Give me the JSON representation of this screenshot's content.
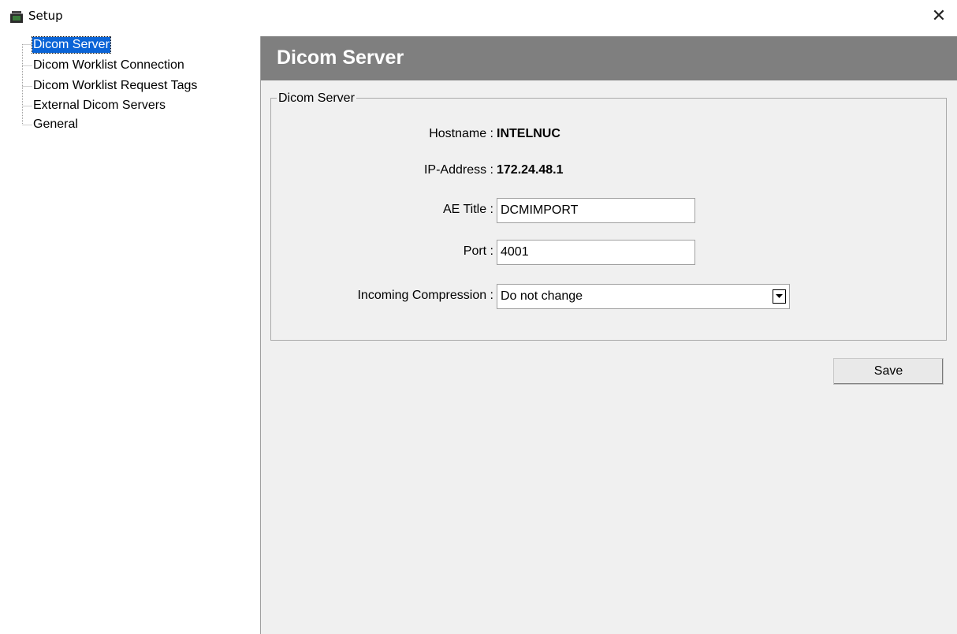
{
  "window": {
    "title": "Setup",
    "close_glyph": "✕",
    "icon": "setup-app-icon"
  },
  "tree": {
    "items": [
      {
        "label": "Dicom Server",
        "selected": true
      },
      {
        "label": "Dicom Worklist Connection",
        "selected": false
      },
      {
        "label": "Dicom Worklist Request Tags",
        "selected": false
      },
      {
        "label": "External Dicom Servers",
        "selected": false
      },
      {
        "label": "General",
        "selected": false
      }
    ]
  },
  "panel": {
    "header_title": "Dicom Server",
    "group_title": "Dicom Server",
    "hostname_label": "Hostname :",
    "hostname_value": "INTELNUC",
    "ip_label": "IP-Address :",
    "ip_value": "172.24.48.1",
    "ae_title_label": "AE Title :",
    "ae_title_value": "DCMIMPORT",
    "port_label": "Port :",
    "port_value": "4001",
    "compression_label": "Incoming Compression :",
    "compression_value": "Do not change",
    "save_label": "Save"
  },
  "colors": {
    "header_band": "#7f7f7f",
    "selection": "#0a64d7",
    "panel_bg": "#f0f0f0"
  }
}
